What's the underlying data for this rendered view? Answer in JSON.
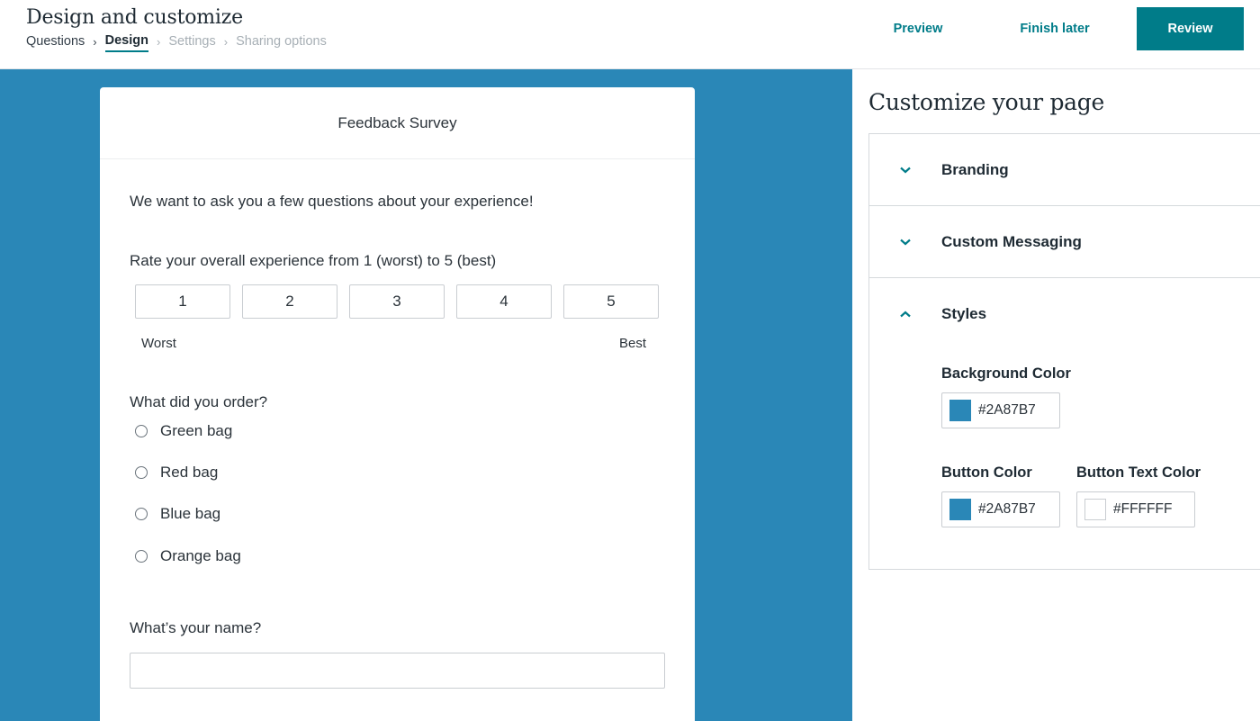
{
  "header": {
    "title": "Design and customize",
    "breadcrumb": [
      "Questions",
      "Design",
      "Settings",
      "Sharing options"
    ],
    "preview_label": "Preview",
    "finish_later_label": "Finish later",
    "review_label": "Review"
  },
  "survey": {
    "title": "Feedback Survey",
    "intro": "We want to ask you a few questions about your experience!",
    "rating_question": "Rate your overall experience from 1 (worst) to 5 (best)",
    "rating_options": [
      "1",
      "2",
      "3",
      "4",
      "5"
    ],
    "rating_low_label": "Worst",
    "rating_high_label": "Best",
    "order_question": "What did you order?",
    "order_options": [
      "Green bag",
      "Red bag",
      "Blue bag",
      "Orange bag"
    ],
    "name_question": "What’s your name?",
    "name_value": ""
  },
  "panel": {
    "title": "Customize your page",
    "sections": [
      "Branding",
      "Custom Messaging",
      "Styles"
    ],
    "background_color_label": "Background Color",
    "background_color_value": "#2A87B7",
    "button_color_label": "Button Color",
    "button_color_value": "#2A87B7",
    "button_text_color_label": "Button Text Color",
    "button_text_color_value": "#FFFFFF"
  },
  "colors": {
    "accent": "#007c89",
    "canvas_background": "#2a87b7"
  },
  "icons": {
    "collapsed_section": "chevron-down-icon",
    "expanded_section": "chevron-up-icon",
    "breadcrumb_separator": "chevron-right-icon"
  }
}
